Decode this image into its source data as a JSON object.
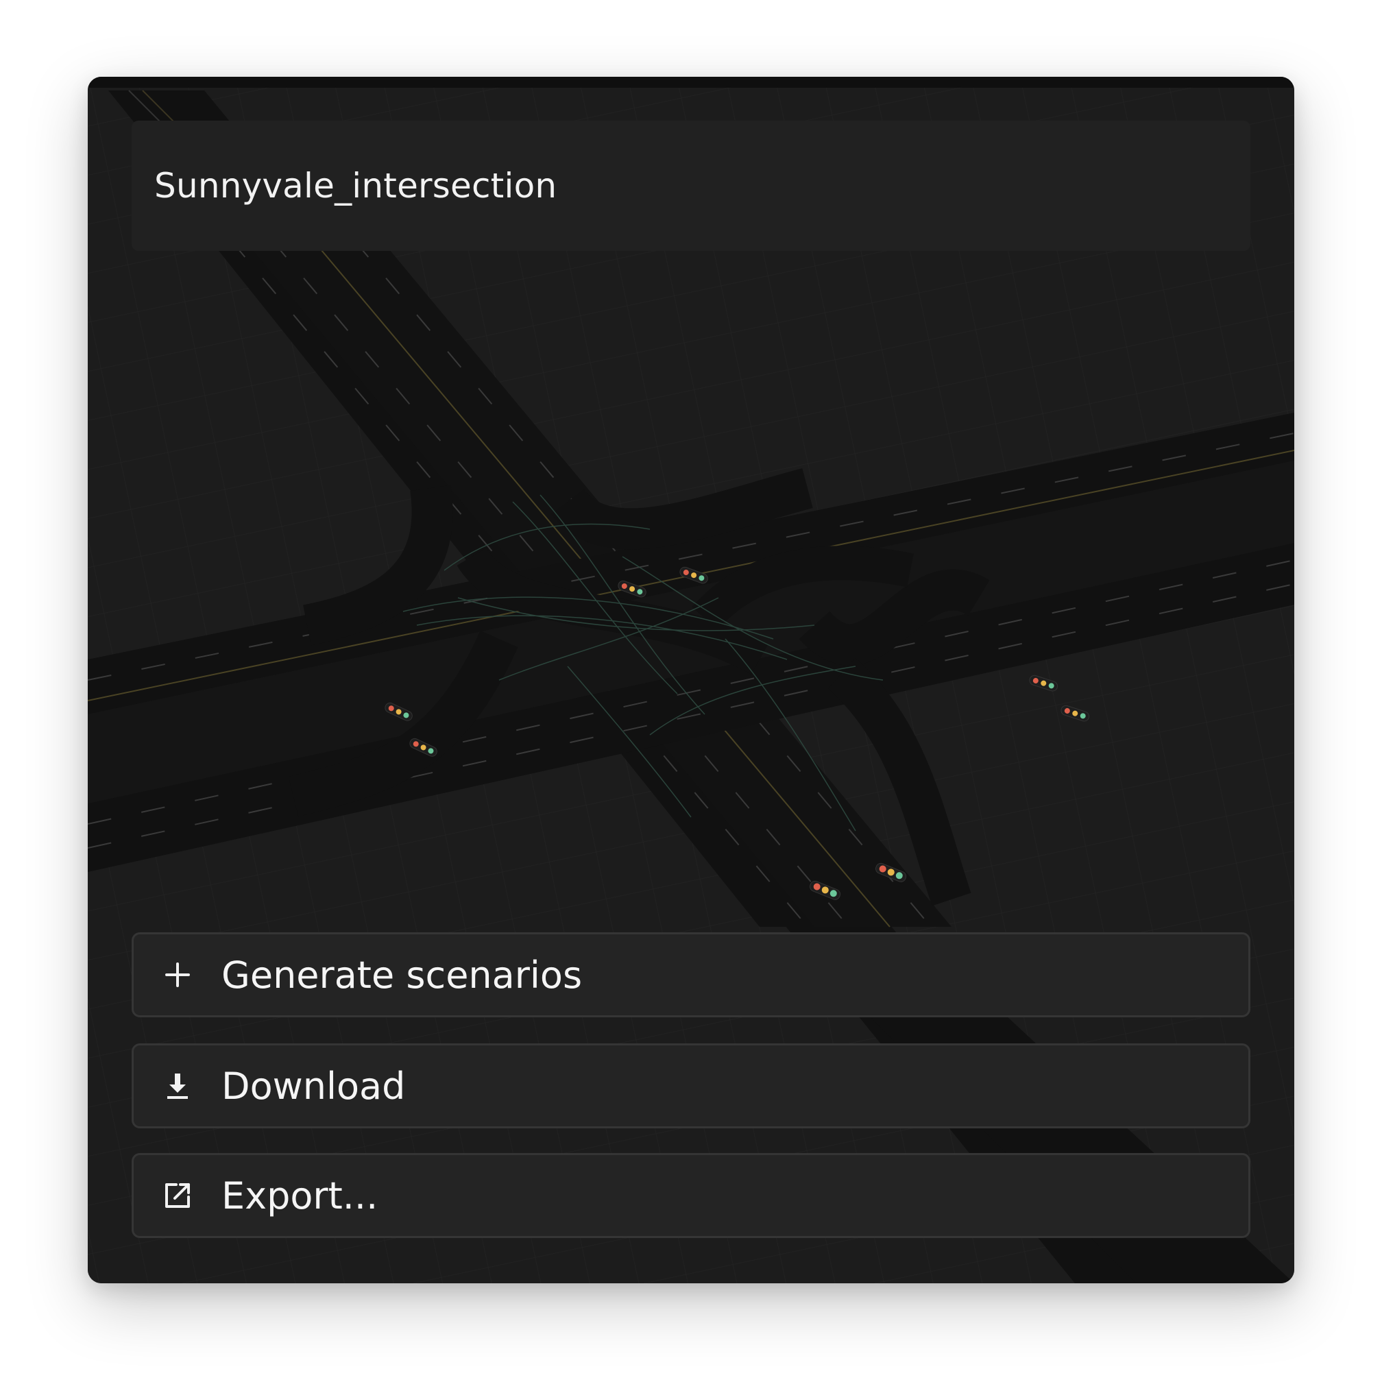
{
  "card": {
    "title": "Sunnyvale_intersection"
  },
  "map": {
    "description_icon": "road-map-icon",
    "traffic_light_colors": [
      "#e0604c",
      "#e8b64a",
      "#6cc79a"
    ]
  },
  "actions": [
    {
      "label": "Generate scenarios",
      "icon": "plus-icon"
    },
    {
      "label": "Download",
      "icon": "download-icon"
    },
    {
      "label": "Export...",
      "icon": "external-link-icon"
    }
  ],
  "colors": {
    "card_background": "#1d1d1d",
    "road": "#101010",
    "button_background": "#242424",
    "button_border": "#353535",
    "text": "#f5f5f5"
  }
}
